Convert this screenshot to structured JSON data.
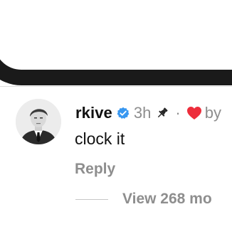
{
  "comment": {
    "username": "rkive",
    "time": "3h",
    "separator": "·",
    "liked_by_prefix": "by",
    "text": "clock it",
    "reply_label": "Reply",
    "view_more_label": "View 268 mo"
  },
  "icons": {
    "verified": "verified-badge-icon",
    "pin": "pin-icon",
    "heart": "heart-icon"
  },
  "colors": {
    "verified_blue": "#3897f0",
    "heart_red": "#ed2d3b",
    "muted_gray": "#8e8e8e",
    "text_black": "#111111"
  }
}
